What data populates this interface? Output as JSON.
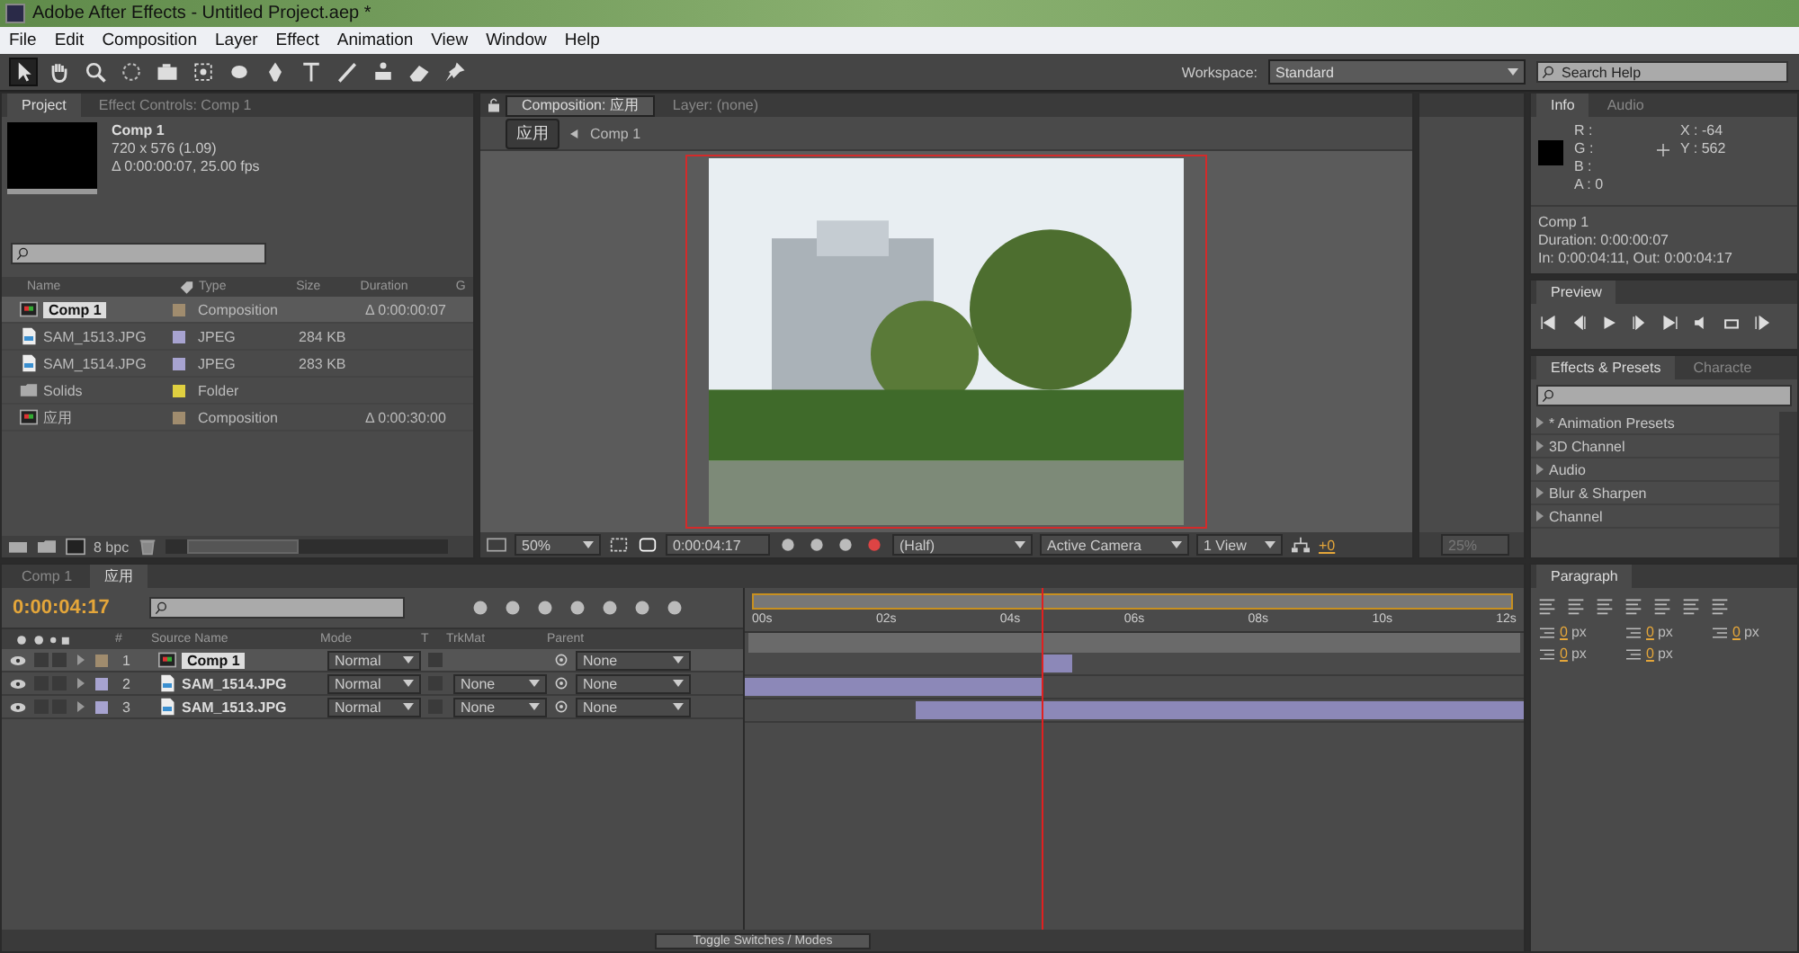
{
  "window": {
    "title": "Adobe After Effects - Untitled Project.aep *"
  },
  "menu": [
    "File",
    "Edit",
    "Composition",
    "Layer",
    "Effect",
    "Animation",
    "View",
    "Window",
    "Help"
  ],
  "toolbar": {
    "workspace_label": "Workspace:",
    "workspace": "Standard",
    "search_placeholder": "Search Help"
  },
  "project": {
    "tabs": [
      {
        "label": "Project",
        "selected": true
      },
      {
        "label": "Effect Controls: Comp 1",
        "selected": false
      }
    ],
    "preview": {
      "name": "Comp 1",
      "dims": "720 x 576 (1.09)",
      "duration": "Δ 0:00:00:07, 25.00 fps"
    },
    "columns": [
      "Name",
      "Type",
      "Size",
      "Duration",
      "G"
    ],
    "items": [
      {
        "kind": "comp",
        "name": "Comp 1",
        "color": "#a08c6e",
        "type": "Composition",
        "duration": "Δ 0:00:00:07",
        "selected": true
      },
      {
        "kind": "image",
        "name": "SAM_1513.JPG",
        "color": "#a7a3d0",
        "type": "JPEG",
        "size": "284 KB",
        "selected": false
      },
      {
        "kind": "image",
        "name": "SAM_1514.JPG",
        "color": "#a7a3d0",
        "type": "JPEG",
        "size": "283 KB",
        "selected": false
      },
      {
        "kind": "folder",
        "name": "Solids",
        "color": "#e0d040",
        "type": "Folder",
        "selected": false
      },
      {
        "kind": "comp",
        "name": "应用",
        "color": "#a08c6e",
        "type": "Composition",
        "duration": "Δ 0:00:30:00",
        "selected": false
      }
    ],
    "bpc": "8 bpc"
  },
  "composition": {
    "tabs": [
      {
        "label": "Composition: 应用",
        "selected": true
      },
      {
        "label": "Layer: (none)",
        "selected": false
      }
    ],
    "breadcrumb": [
      "应用",
      "Comp 1"
    ],
    "footer": {
      "zoom": "50%",
      "timecode": "0:00:04:17",
      "resolution": "(Half)",
      "camera": "Active Camera",
      "views": "1 View",
      "exposure": "+0"
    }
  },
  "side_panel": {
    "zoom": "25%"
  },
  "info": {
    "tabs": [
      {
        "label": "Info",
        "selected": true
      },
      {
        "label": "Audio",
        "selected": false
      }
    ],
    "channels": [
      "R :",
      "G :",
      "B :",
      "A : 0"
    ],
    "coords": [
      "X : -64",
      "Y : 562"
    ],
    "lines": [
      "Comp 1",
      "Duration: 0:00:00:07",
      "In: 0:00:04:11, Out: 0:00:04:17"
    ]
  },
  "preview": {
    "title": "Preview"
  },
  "effects": {
    "tabs": [
      {
        "label": "Effects & Presets",
        "selected": true
      },
      {
        "label": "Characte",
        "selected": false
      }
    ],
    "items": [
      "* Animation Presets",
      "3D Channel",
      "Audio",
      "Blur & Sharpen",
      "Channel"
    ]
  },
  "timeline": {
    "tabs": [
      {
        "label": "Comp 1",
        "selected": false
      },
      {
        "label": "应用",
        "selected": true
      }
    ],
    "timecode": "0:00:04:17",
    "columns": [
      "#",
      "Source Name",
      "Mode",
      "T",
      "TrkMat",
      "Parent"
    ],
    "ruler": [
      "00s",
      "02s",
      "04s",
      "06s",
      "08s",
      "10s",
      "12s"
    ],
    "layers": [
      {
        "num": "1",
        "name": "Comp 1",
        "color": "#a08c6e",
        "kind": "comp",
        "mode": "Normal",
        "parent": "None",
        "selected": true
      },
      {
        "num": "2",
        "name": "SAM_1514.JPG",
        "color": "#a7a3d0",
        "kind": "image",
        "mode": "Normal",
        "trkmat": "None",
        "parent": "None",
        "selected": false
      },
      {
        "num": "3",
        "name": "SAM_1513.JPG",
        "color": "#a7a3d0",
        "kind": "image",
        "mode": "Normal",
        "trkmat": "None",
        "parent": "None",
        "selected": false
      }
    ],
    "status": "Toggle Switches / Modes"
  },
  "paragraph": {
    "title": "Paragraph",
    "fields": [
      {
        "value": "0",
        "unit": "px"
      },
      {
        "value": "0",
        "unit": "px"
      },
      {
        "value": "0",
        "unit": "px"
      },
      {
        "value": "0",
        "unit": "px"
      },
      {
        "value": "0",
        "unit": "px"
      }
    ]
  }
}
